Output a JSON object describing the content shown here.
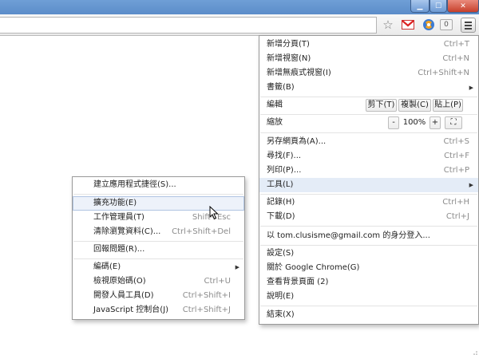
{
  "toolbar": {
    "badge_count": "0",
    "star_icon": "star-icon",
    "gmail_icon": "gmail-icon",
    "extension_icon": "extension-icon",
    "menu_icon": "hamburger-menu-icon"
  },
  "main_menu": {
    "new_tab": {
      "label": "新增分頁(T)",
      "shortcut": "Ctrl+T"
    },
    "new_window": {
      "label": "新增視窗(N)",
      "shortcut": "Ctrl+N"
    },
    "new_incognito": {
      "label": "新增無痕式視窗(I)",
      "shortcut": "Ctrl+Shift+N"
    },
    "bookmarks": {
      "label": "書籤(B)"
    },
    "edit": {
      "label": "編輯",
      "cut": "剪下(T)",
      "copy": "複製(C)",
      "paste": "貼上(P)"
    },
    "zoom": {
      "label": "縮放",
      "minus": "-",
      "value": "100%",
      "plus": "+",
      "fullscreen": "⛶"
    },
    "save_page": {
      "label": "另存網頁為(A)...",
      "shortcut": "Ctrl+S"
    },
    "find": {
      "label": "尋找(F)...",
      "shortcut": "Ctrl+F"
    },
    "print": {
      "label": "列印(P)...",
      "shortcut": "Ctrl+P"
    },
    "tools": {
      "label": "工具(L)"
    },
    "history": {
      "label": "記錄(H)",
      "shortcut": "Ctrl+H"
    },
    "downloads": {
      "label": "下載(D)",
      "shortcut": "Ctrl+J"
    },
    "sign_in": {
      "label": "以 tom.clusisme@gmail.com 的身分登入..."
    },
    "settings": {
      "label": "設定(S)"
    },
    "about": {
      "label": "關於 Google Chrome(G)"
    },
    "background_pages": {
      "label": "查看背景頁面 (2)"
    },
    "help": {
      "label": "說明(E)"
    },
    "exit": {
      "label": "結束(X)"
    }
  },
  "tools_submenu": {
    "create_shortcuts": {
      "label": "建立應用程式捷徑(S)..."
    },
    "extensions": {
      "label": "擴充功能(E)"
    },
    "task_manager": {
      "label": "工作管理員(T)",
      "shortcut": "Shift+Esc"
    },
    "clear_data": {
      "label": "清除瀏覽資料(C)...",
      "shortcut": "Ctrl+Shift+Del"
    },
    "report_issue": {
      "label": "回報問題(R)..."
    },
    "encoding": {
      "label": "編碼(E)"
    },
    "view_source": {
      "label": "檢視原始碼(O)",
      "shortcut": "Ctrl+U"
    },
    "dev_tools": {
      "label": "開發人員工具(D)",
      "shortcut": "Ctrl+Shift+I"
    },
    "js_console": {
      "label": "JavaScript 控制台(J)",
      "shortcut": "Ctrl+Shift+J"
    }
  }
}
